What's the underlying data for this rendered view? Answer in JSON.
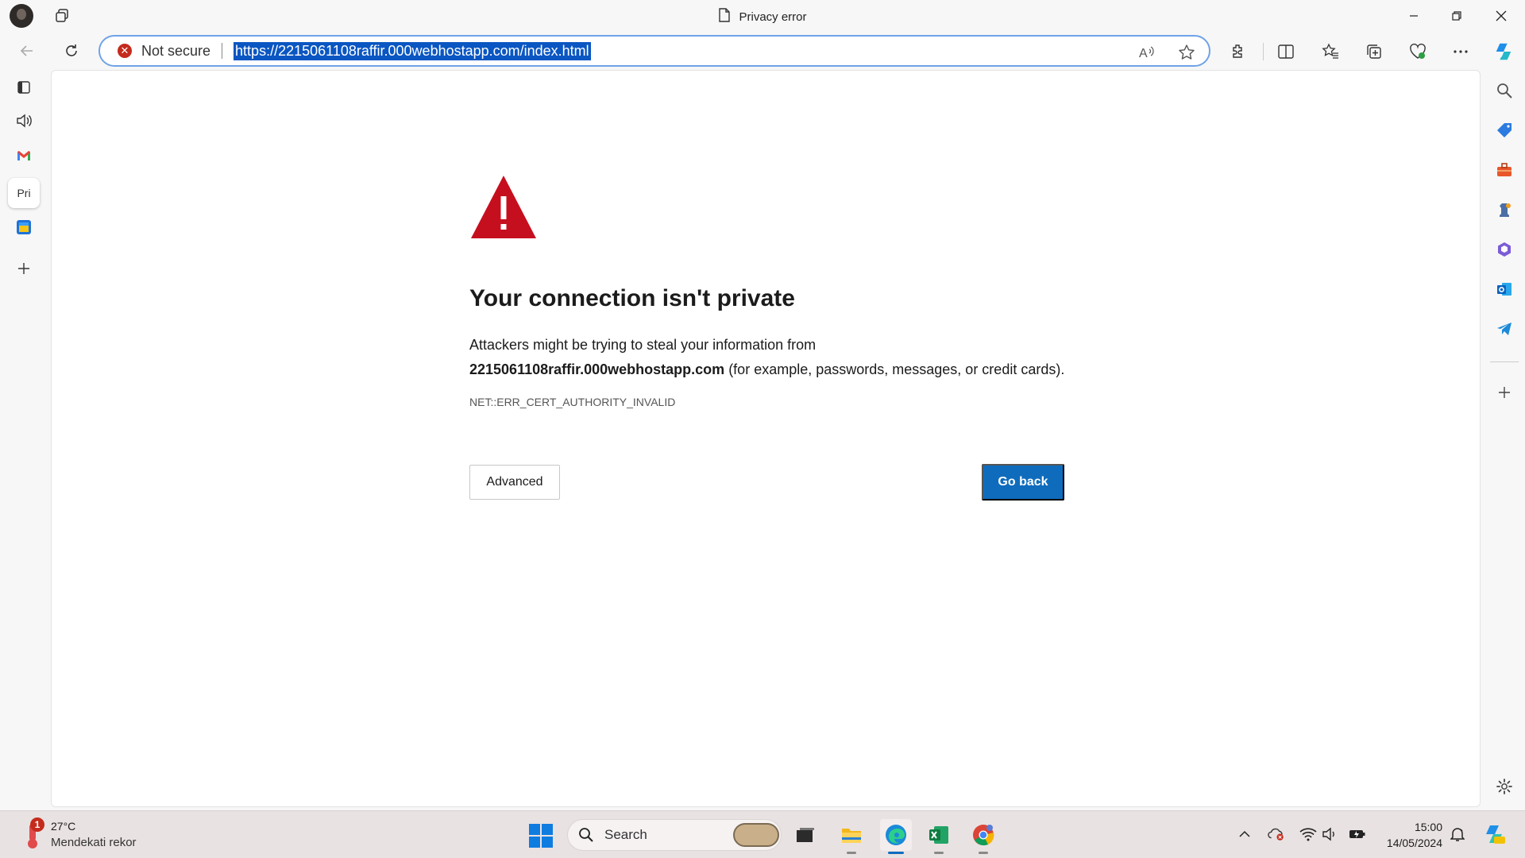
{
  "window": {
    "title": "Privacy error",
    "controls": [
      "minimize",
      "restore",
      "close"
    ]
  },
  "toolbar": {
    "back_icon": "back-arrow-icon",
    "refresh_icon": "refresh-icon",
    "security_label": "Not secure",
    "url": "https://2215061108raffir.000webhostapp.com/index.html"
  },
  "sidebar_tabs": {
    "active_tab_label": "Pri"
  },
  "error_page": {
    "heading": "Your connection isn't private",
    "line1": "Attackers might be trying to steal your information from",
    "domain": "2215061108raffir.000webhostapp.com",
    "line2_rest": " (for example, passwords, messages, or credit cards).",
    "error_code": "NET::ERR_CERT_AUTHORITY_INVALID",
    "advanced_label": "Advanced",
    "go_back_label": "Go back"
  },
  "taskbar": {
    "weather_badge": "1",
    "weather_temp": "27°C",
    "weather_desc": "Mendekati rekor",
    "search_label": "Search",
    "clock_time": "15:00",
    "clock_date": "14/05/2024"
  },
  "colors": {
    "accent": "#0f6cbd",
    "warning_red": "#c50f1f",
    "address_border": "#6fa3e7"
  }
}
